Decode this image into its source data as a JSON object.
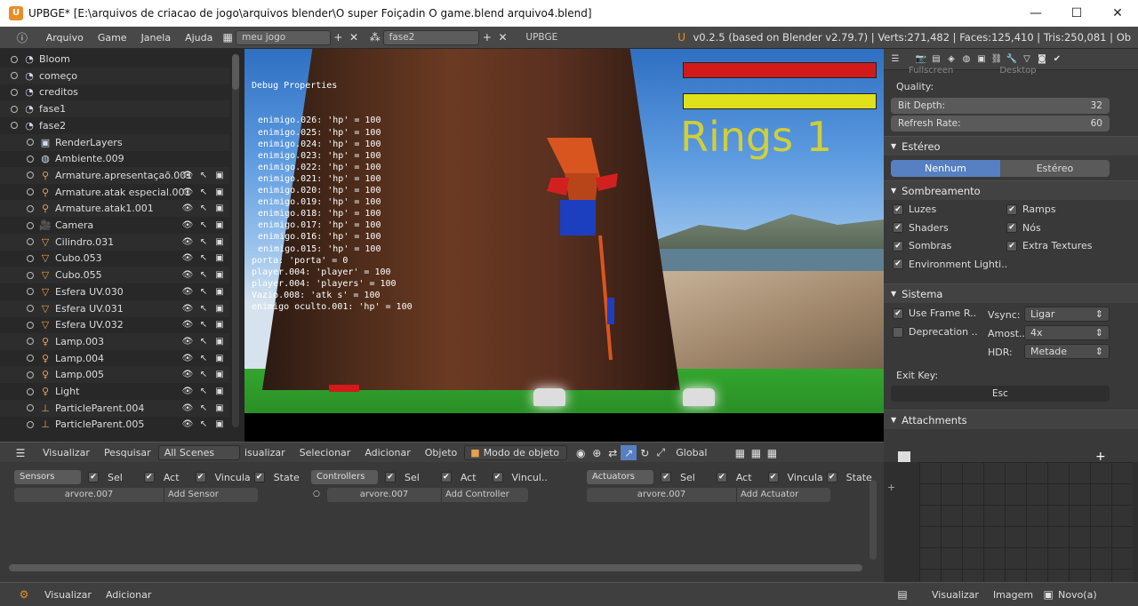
{
  "window": {
    "title": "UPBGE* [E:\\arquivos de criacao de jogo\\arquivos blender\\O super Foiçadin O game.blend arquivo4.blend]",
    "minimize": "—",
    "maximize": "☐",
    "close": "✕"
  },
  "topbar": {
    "menus": [
      "Arquivo",
      "Game",
      "Janela",
      "Ajuda"
    ],
    "screen_field": "meu jogo",
    "scene_field": "fase2",
    "engine_field": "UPBGE",
    "stats": "v0.2.5 (based on Blender v2.79.7) | Verts:271,482 | Faces:125,410 | Tris:250,081 | Ob"
  },
  "outliner": {
    "rows": [
      {
        "name": "Bloom",
        "indent": 0,
        "icon": "scene"
      },
      {
        "name": "começo",
        "indent": 0,
        "icon": "scene"
      },
      {
        "name": "creditos",
        "indent": 0,
        "icon": "scene"
      },
      {
        "name": "fase1",
        "indent": 0,
        "icon": "scene"
      },
      {
        "name": "fase2",
        "indent": 0,
        "icon": "scene"
      },
      {
        "name": "RenderLayers",
        "indent": 1,
        "icon": "renderlayers"
      },
      {
        "name": "Ambiente.009",
        "indent": 1,
        "icon": "world"
      },
      {
        "name": "Armature.apresentaçaõ.001",
        "indent": 1,
        "icon": "armature"
      },
      {
        "name": "Armature.atak especial.001",
        "indent": 1,
        "icon": "armature"
      },
      {
        "name": "Armature.atak1.001",
        "indent": 1,
        "icon": "armature"
      },
      {
        "name": "Camera",
        "indent": 1,
        "icon": "camera"
      },
      {
        "name": "Cilindro.031",
        "indent": 1,
        "icon": "mesh"
      },
      {
        "name": "Cubo.053",
        "indent": 1,
        "icon": "mesh"
      },
      {
        "name": "Cubo.055",
        "indent": 1,
        "icon": "mesh"
      },
      {
        "name": "Esfera UV.030",
        "indent": 1,
        "icon": "mesh"
      },
      {
        "name": "Esfera UV.031",
        "indent": 1,
        "icon": "mesh"
      },
      {
        "name": "Esfera UV.032",
        "indent": 1,
        "icon": "mesh"
      },
      {
        "name": "Lamp.003",
        "indent": 1,
        "icon": "lamp"
      },
      {
        "name": "Lamp.004",
        "indent": 1,
        "icon": "lamp"
      },
      {
        "name": "Lamp.005",
        "indent": 1,
        "icon": "lamp"
      },
      {
        "name": "Light",
        "indent": 1,
        "icon": "lamp"
      },
      {
        "name": "ParticleParent.004",
        "indent": 1,
        "icon": "empty"
      },
      {
        "name": "ParticleParent.005",
        "indent": 1,
        "icon": "empty"
      }
    ],
    "footer": {
      "visualizar": "Visualizar",
      "pesquisar": "Pesquisar",
      "scenes": "All Scenes"
    }
  },
  "viewport": {
    "debug_title": "Debug Properties",
    "debug_lines": [
      "enimigo.026: 'hp' = 100",
      "enimigo.025: 'hp' = 100",
      "enimigo.024: 'hp' = 100",
      "enimigo.023: 'hp' = 100",
      "enimigo.022: 'hp' = 100",
      "enimigo.021: 'hp' = 100",
      "enimigo.020: 'hp' = 100",
      "enimigo.019: 'hp' = 100",
      "enimigo.018: 'hp' = 100",
      "enimigo.017: 'hp' = 100",
      "enimigo.016: 'hp' = 100",
      "enimigo.015: 'hp' = 100",
      "porta: 'porta' = 0",
      "player.004: 'player' = 100",
      "player.004: 'players' = 100",
      "Vazio.008: 'atk s' = 100",
      "enimigo oculto.001: 'hp' = 100"
    ],
    "hud_text": "Rings 1",
    "colors": {
      "health": "#d21a1a",
      "energy": "#e0e11a",
      "rings": "#e6da1e"
    },
    "header": {
      "visualizar": "isualizar",
      "selecionar": "Selecionar",
      "adicionar": "Adicionar",
      "objeto": "Objeto",
      "mode": "Modo de objeto",
      "orientation": "Global"
    }
  },
  "properties": {
    "top_cut": "Fullscreen",
    "top_cut2": "Desktop",
    "quality_label": "Quality:",
    "bit_depth_label": "Bit Depth:",
    "bit_depth_value": "32",
    "refresh_label": "Refresh Rate:",
    "refresh_value": "60",
    "stereo_panel": "Estéreo",
    "stereo_none": "Nenhum",
    "stereo_on": "Estéreo",
    "shading_panel": "Sombreamento",
    "shading": [
      {
        "label": "Luzes",
        "checked": true
      },
      {
        "label": "Ramps",
        "checked": true
      },
      {
        "label": "Shaders",
        "checked": true
      },
      {
        "label": "Nós",
        "checked": true
      },
      {
        "label": "Sombras",
        "checked": true
      },
      {
        "label": "Extra Textures",
        "checked": true
      },
      {
        "label": "Environment Lighti..",
        "checked": true
      }
    ],
    "system_panel": "Sistema",
    "use_frame": "Use Frame R..",
    "deprecation": "Deprecation ..",
    "vsync_label": "Vsync:",
    "vsync_value": "Ligar",
    "samples_label": "Amost..",
    "samples_value": "4x",
    "hdr_label": "HDR:",
    "hdr_value": "Metade",
    "exit_key_label": "Exit Key:",
    "exit_key_value": "Esc",
    "attachments_panel": "Attachments"
  },
  "logic": {
    "sensors": "Sensors",
    "controllers": "Controllers",
    "actuators": "Actuators",
    "sel": "Sel",
    "act": "Act",
    "vincula": "Vincula",
    "vincul": "Vincul..",
    "state": "State",
    "object": "arvore.007",
    "add_sensor": "Add Sensor",
    "add_controller": "Add Controller",
    "add_actuator": "Add Actuator"
  },
  "bottom": {
    "visualizar": "Visualizar",
    "adicionar": "Adicionar",
    "visualizar2": "Visualizar",
    "imagem": "Imagem",
    "novo": "Novo(a)"
  }
}
